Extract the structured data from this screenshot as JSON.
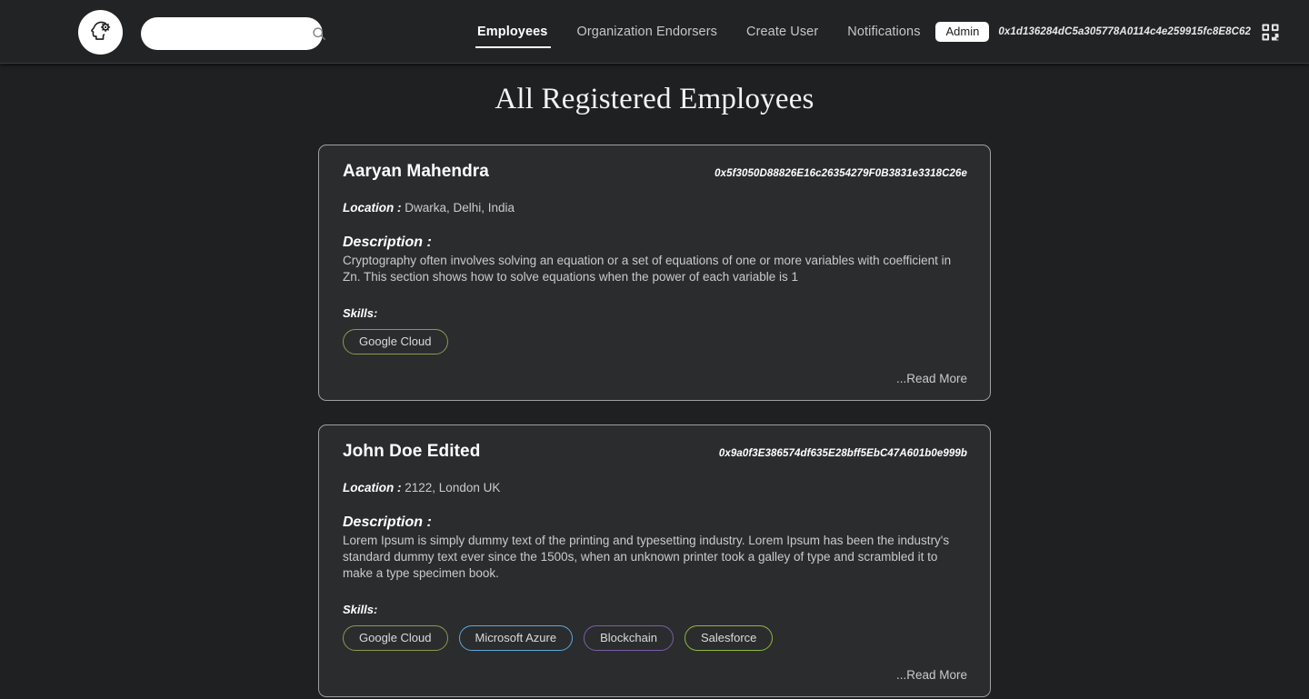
{
  "header": {
    "logo_icon": "head-gear-logo-icon",
    "search": {
      "value": "",
      "placeholder": ""
    },
    "search_icon": "search-icon",
    "nav": [
      {
        "label": "Employees",
        "active": true
      },
      {
        "label": "Organization Endorsers",
        "active": false
      },
      {
        "label": "Create User",
        "active": false
      },
      {
        "label": "Notifications",
        "active": false
      }
    ],
    "account": {
      "role_badge": "Admin",
      "wallet_address": "0x1d136284dC5a305778A0114c4e259915fc8E8C62",
      "qr_icon": "qr-code-icon"
    }
  },
  "main": {
    "page_title": "All Registered Employees",
    "labels": {
      "location": "Location :",
      "description": "Description :",
      "skills": "Skills:",
      "read_more": "...Read More"
    },
    "employees": [
      {
        "name": "Aaryan Mahendra",
        "address": "0x5f3050D88826E16c26354279F0B3831e3318C26e",
        "location": "Dwarka, Delhi, India",
        "description": "Cryptography often involves solving an equation or a set of equations of one or more variables with coefficient in Zn. This section shows how to solve equations when the power of each variable is 1",
        "skills": [
          {
            "label": "Google Cloud",
            "color": "#8a9a4e"
          }
        ]
      },
      {
        "name": "John Doe Edited",
        "address": "0x9a0f3E386574df635E28bff5EbC47A601b0e999b",
        "location": "2122, London UK",
        "description": "Lorem Ipsum is simply dummy text of the printing and typesetting industry. Lorem Ipsum has been the industry's standard dummy text ever since the 1500s, when an unknown printer took a galley of type and scrambled it to make a type specimen book.",
        "skills": [
          {
            "label": "Google Cloud",
            "color": "#8a9a4e"
          },
          {
            "label": "Microsoft Azure",
            "color": "#5ba9dd"
          },
          {
            "label": "Blockchain",
            "color": "#7b5ea7"
          },
          {
            "label": "Salesforce",
            "color": "#8fb83a"
          }
        ]
      }
    ]
  },
  "colors": {
    "page_background": "#1f2022",
    "header_background": "#222325",
    "card_background": "#2b2c2e",
    "card_border": "#9fa0a2",
    "text_primary": "#ffffff",
    "text_secondary": "#c9cacc"
  }
}
